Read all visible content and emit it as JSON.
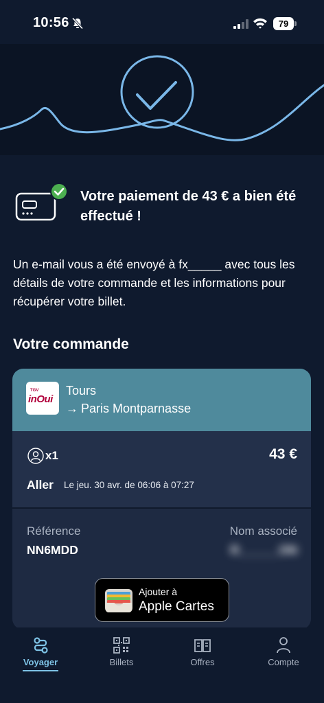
{
  "status_bar": {
    "time": "10:56",
    "battery": "79"
  },
  "confirmation": {
    "title": "Votre paiement de 43 € a bien été effectué !",
    "email_text": "Un e-mail vous a été envoyé à fx_____ avec tous les détails de votre commande et les informations pour récupérer votre billet."
  },
  "order": {
    "section_title": "Votre commande",
    "logo_small": "TGV",
    "logo_big": "inOui",
    "origin": "Tours",
    "arrow": "→",
    "destination": "Paris Montparnasse",
    "passengers": "x1",
    "price": "43 €",
    "direction": "Aller",
    "schedule": "Le jeu. 30 avr. de 06:06 à 07:27",
    "reference_label": "Référence",
    "reference_value": "NN6MDD",
    "name_label": "Nom associé",
    "name_value": "R______ON",
    "wallet_line1": "Ajouter à",
    "wallet_line2": "Apple Cartes"
  },
  "tabs": [
    {
      "label": "Voyager",
      "icon": "route-icon",
      "active": true
    },
    {
      "label": "Billets",
      "icon": "qr-code-icon",
      "active": false
    },
    {
      "label": "Offres",
      "icon": "book-icon",
      "active": false
    },
    {
      "label": "Compte",
      "icon": "person-icon",
      "active": false
    }
  ],
  "colors": {
    "background": "#0f1a2e",
    "header_teal": "#4f8a9c",
    "accent": "#7ec3e6",
    "success_green": "#4caf50",
    "brand": "#b1003b"
  }
}
